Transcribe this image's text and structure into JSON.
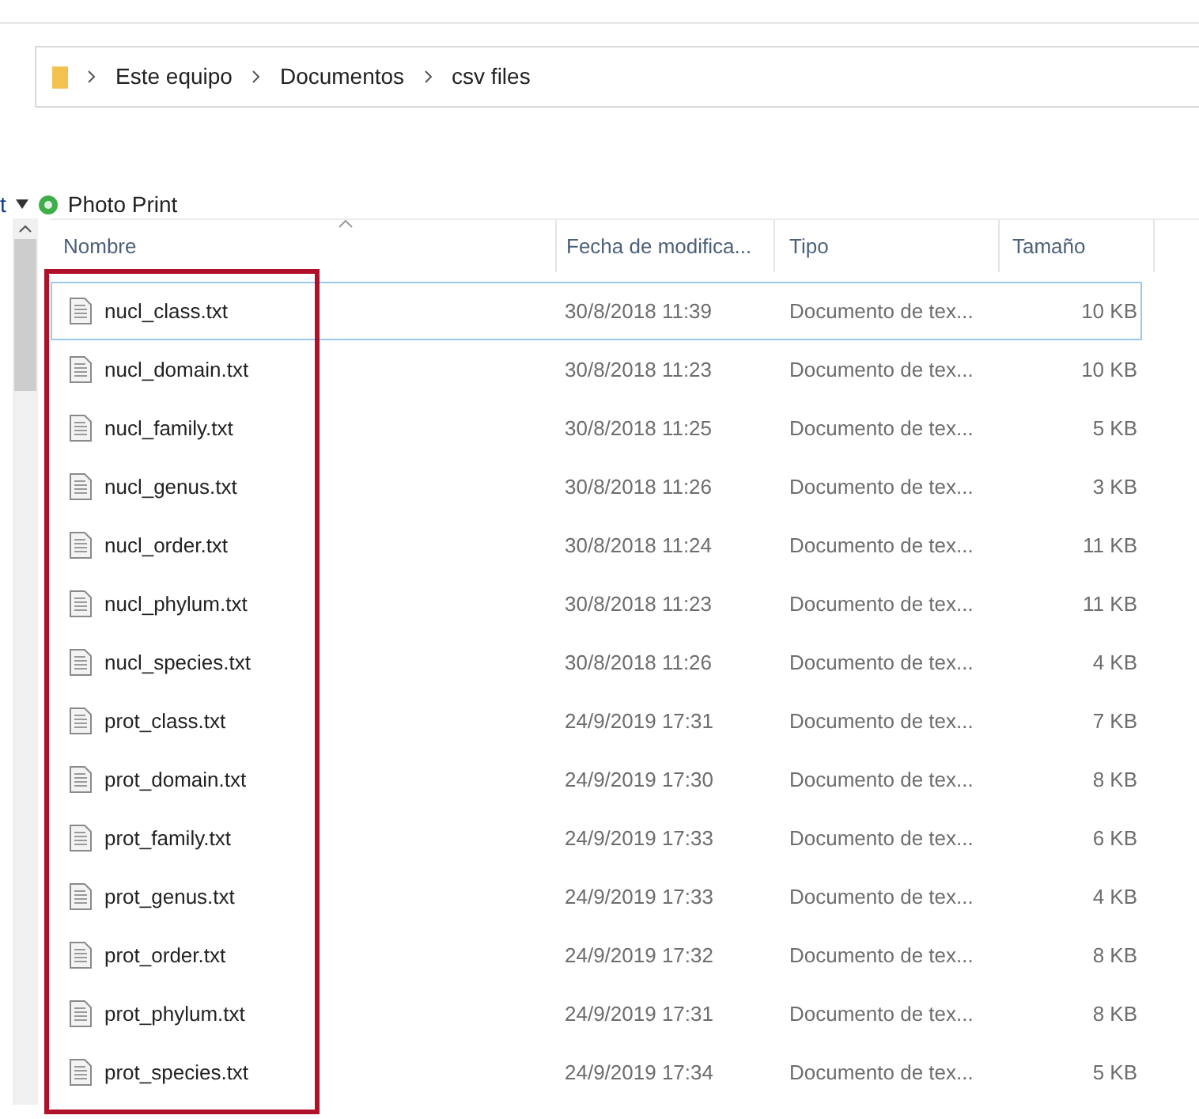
{
  "breadcrumb": [
    "Este equipo",
    "Documentos",
    "csv files"
  ],
  "tree": {
    "cut_label": "t",
    "label": "Photo Print",
    "expanded": true
  },
  "table": {
    "columns": [
      "Nombre",
      "Fecha de modifica...",
      "Tipo",
      "Tamaño"
    ],
    "rows": [
      {
        "name": "nucl_class.txt",
        "date": "30/8/2018 11:39",
        "type": "Documento de tex...",
        "size": "10 KB",
        "focused": true
      },
      {
        "name": "nucl_domain.txt",
        "date": "30/8/2018 11:23",
        "type": "Documento de tex...",
        "size": "10 KB",
        "focused": false
      },
      {
        "name": "nucl_family.txt",
        "date": "30/8/2018 11:25",
        "type": "Documento de tex...",
        "size": "5 KB",
        "focused": false
      },
      {
        "name": "nucl_genus.txt",
        "date": "30/8/2018 11:26",
        "type": "Documento de tex...",
        "size": "3 KB",
        "focused": false
      },
      {
        "name": "nucl_order.txt",
        "date": "30/8/2018 11:24",
        "type": "Documento de tex...",
        "size": "11 KB",
        "focused": false
      },
      {
        "name": "nucl_phylum.txt",
        "date": "30/8/2018 11:23",
        "type": "Documento de tex...",
        "size": "11 KB",
        "focused": false
      },
      {
        "name": "nucl_species.txt",
        "date": "30/8/2018 11:26",
        "type": "Documento de tex...",
        "size": "4 KB",
        "focused": false
      },
      {
        "name": "prot_class.txt",
        "date": "24/9/2019 17:31",
        "type": "Documento de tex...",
        "size": "7 KB",
        "focused": false
      },
      {
        "name": "prot_domain.txt",
        "date": "24/9/2019 17:30",
        "type": "Documento de tex...",
        "size": "8 KB",
        "focused": false
      },
      {
        "name": "prot_family.txt",
        "date": "24/9/2019 17:33",
        "type": "Documento de tex...",
        "size": "6 KB",
        "focused": false
      },
      {
        "name": "prot_genus.txt",
        "date": "24/9/2019 17:33",
        "type": "Documento de tex...",
        "size": "4 KB",
        "focused": false
      },
      {
        "name": "prot_order.txt",
        "date": "24/9/2019 17:32",
        "type": "Documento de tex...",
        "size": "8 KB",
        "focused": false
      },
      {
        "name": "prot_phylum.txt",
        "date": "24/9/2019 17:31",
        "type": "Documento de tex...",
        "size": "8 KB",
        "focused": false
      },
      {
        "name": "prot_species.txt",
        "date": "24/9/2019 17:34",
        "type": "Documento de tex...",
        "size": "5 KB",
        "focused": false
      }
    ]
  }
}
